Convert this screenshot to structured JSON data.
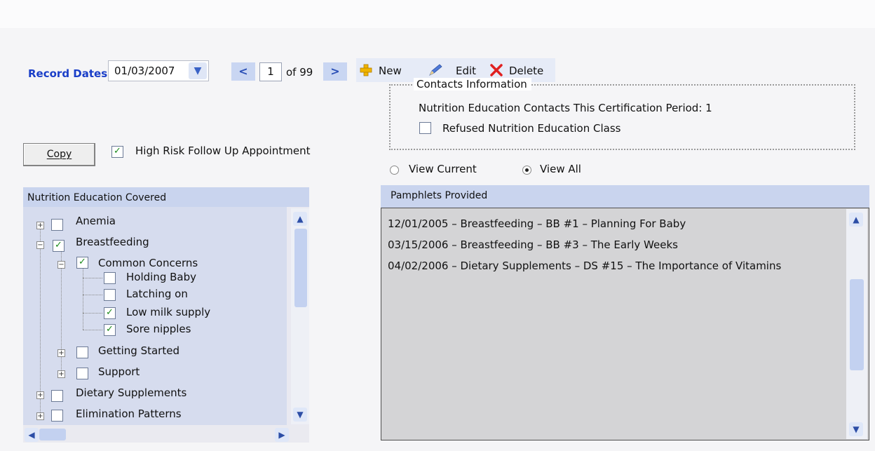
{
  "toolbar": {
    "record_dates_label": "Record Dates",
    "record_date_value": "01/03/2007",
    "page_current": "1",
    "page_of": "of 99",
    "new_label": "New",
    "edit_label": "Edit",
    "delete_label": "Delete"
  },
  "contacts": {
    "legend": "Contacts Information",
    "contacts_text": "Nutrition Education Contacts This Certification Period:  1",
    "refused_label": "Refused Nutrition Education Class"
  },
  "copy_label": "Copy",
  "high_risk_label": "High Risk Follow Up Appointment",
  "tree": {
    "header": "Nutrition Education Covered",
    "items": [
      {
        "label": "Anemia",
        "checked": false
      },
      {
        "label": "Breastfeeding",
        "checked": true
      },
      {
        "label": "Common Concerns",
        "checked": true
      },
      {
        "label": "Holding Baby",
        "checked": false
      },
      {
        "label": "Latching on",
        "checked": false
      },
      {
        "label": "Low milk supply",
        "checked": true
      },
      {
        "label": "Sore nipples",
        "checked": true
      },
      {
        "label": "Getting Started",
        "checked": false
      },
      {
        "label": "Support",
        "checked": false
      },
      {
        "label": "Dietary Supplements",
        "checked": false
      },
      {
        "label": "Elimination Patterns",
        "checked": false
      }
    ]
  },
  "view": {
    "current_label": "View Current",
    "all_label": "View All",
    "selected": "View All"
  },
  "pamphlets": {
    "header": "Pamphlets Provided",
    "items": [
      "12/01/2005 – Breastfeeding – BB #1 – Planning For Baby",
      "03/15/2006 – Breastfeeding – BB #3 – The Early Weeks",
      "04/02/2006 – Dietary Supplements – DS #15 – The Importance of Vitamins"
    ]
  },
  "colors": {
    "accent": "#1a3ec8",
    "header_bg": "#c9d4ee",
    "delete_red": "#e02020"
  }
}
